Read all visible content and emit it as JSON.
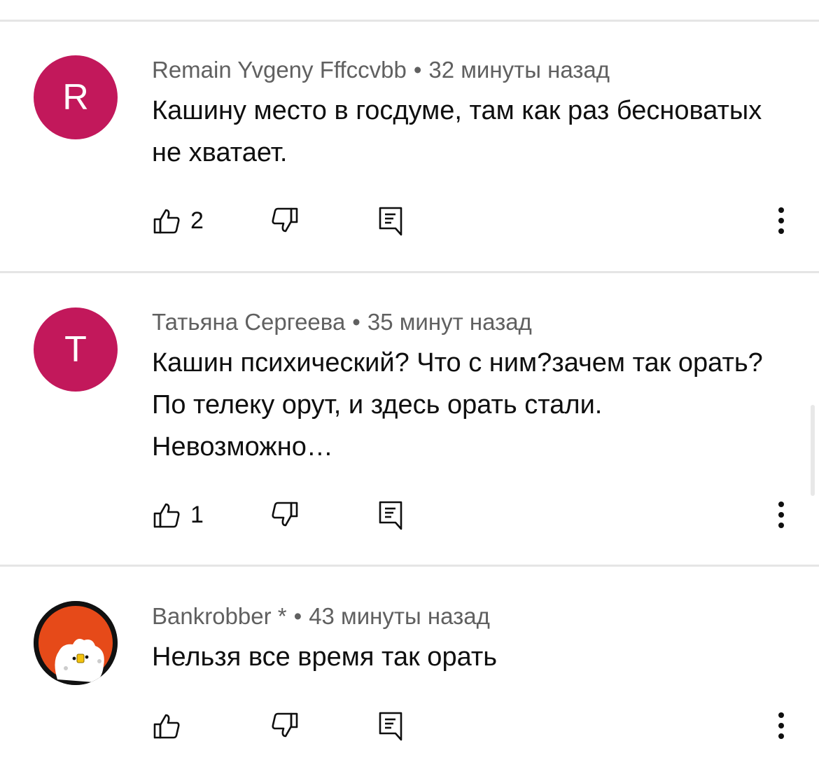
{
  "comments": [
    {
      "avatar_letter": "R",
      "avatar_color": "#c2185b",
      "author": "Remain Yvgeny Fffccvbb",
      "separator": "•",
      "time": "32 минуты назад",
      "text": "Кашину место в госдуме, там как раз бесноватых не хватает.",
      "likes": "2"
    },
    {
      "avatar_letter": "T",
      "avatar_color": "#c2185b",
      "author": "Татьяна Сергеева",
      "separator": "•",
      "time": "35 минут назад",
      "text": "Кашин психический? Что с ним?зачем так орать? По телеку орут, и здесь орать стали. Невозможно…",
      "likes": "1"
    },
    {
      "avatar_letter": "",
      "avatar_color": "#e64a19",
      "author": "Bankrobber *",
      "separator": "•",
      "time": "43 минуты назад",
      "text": "Нельзя все время так орать",
      "likes": ""
    }
  ],
  "icons": {
    "like": "thumb-up-icon",
    "dislike": "thumb-down-icon",
    "reply": "reply-icon",
    "more": "more-vert-icon"
  },
  "colors": {
    "text_primary": "#0f0f0f",
    "text_secondary": "#606060",
    "divider": "#e5e5e5"
  }
}
